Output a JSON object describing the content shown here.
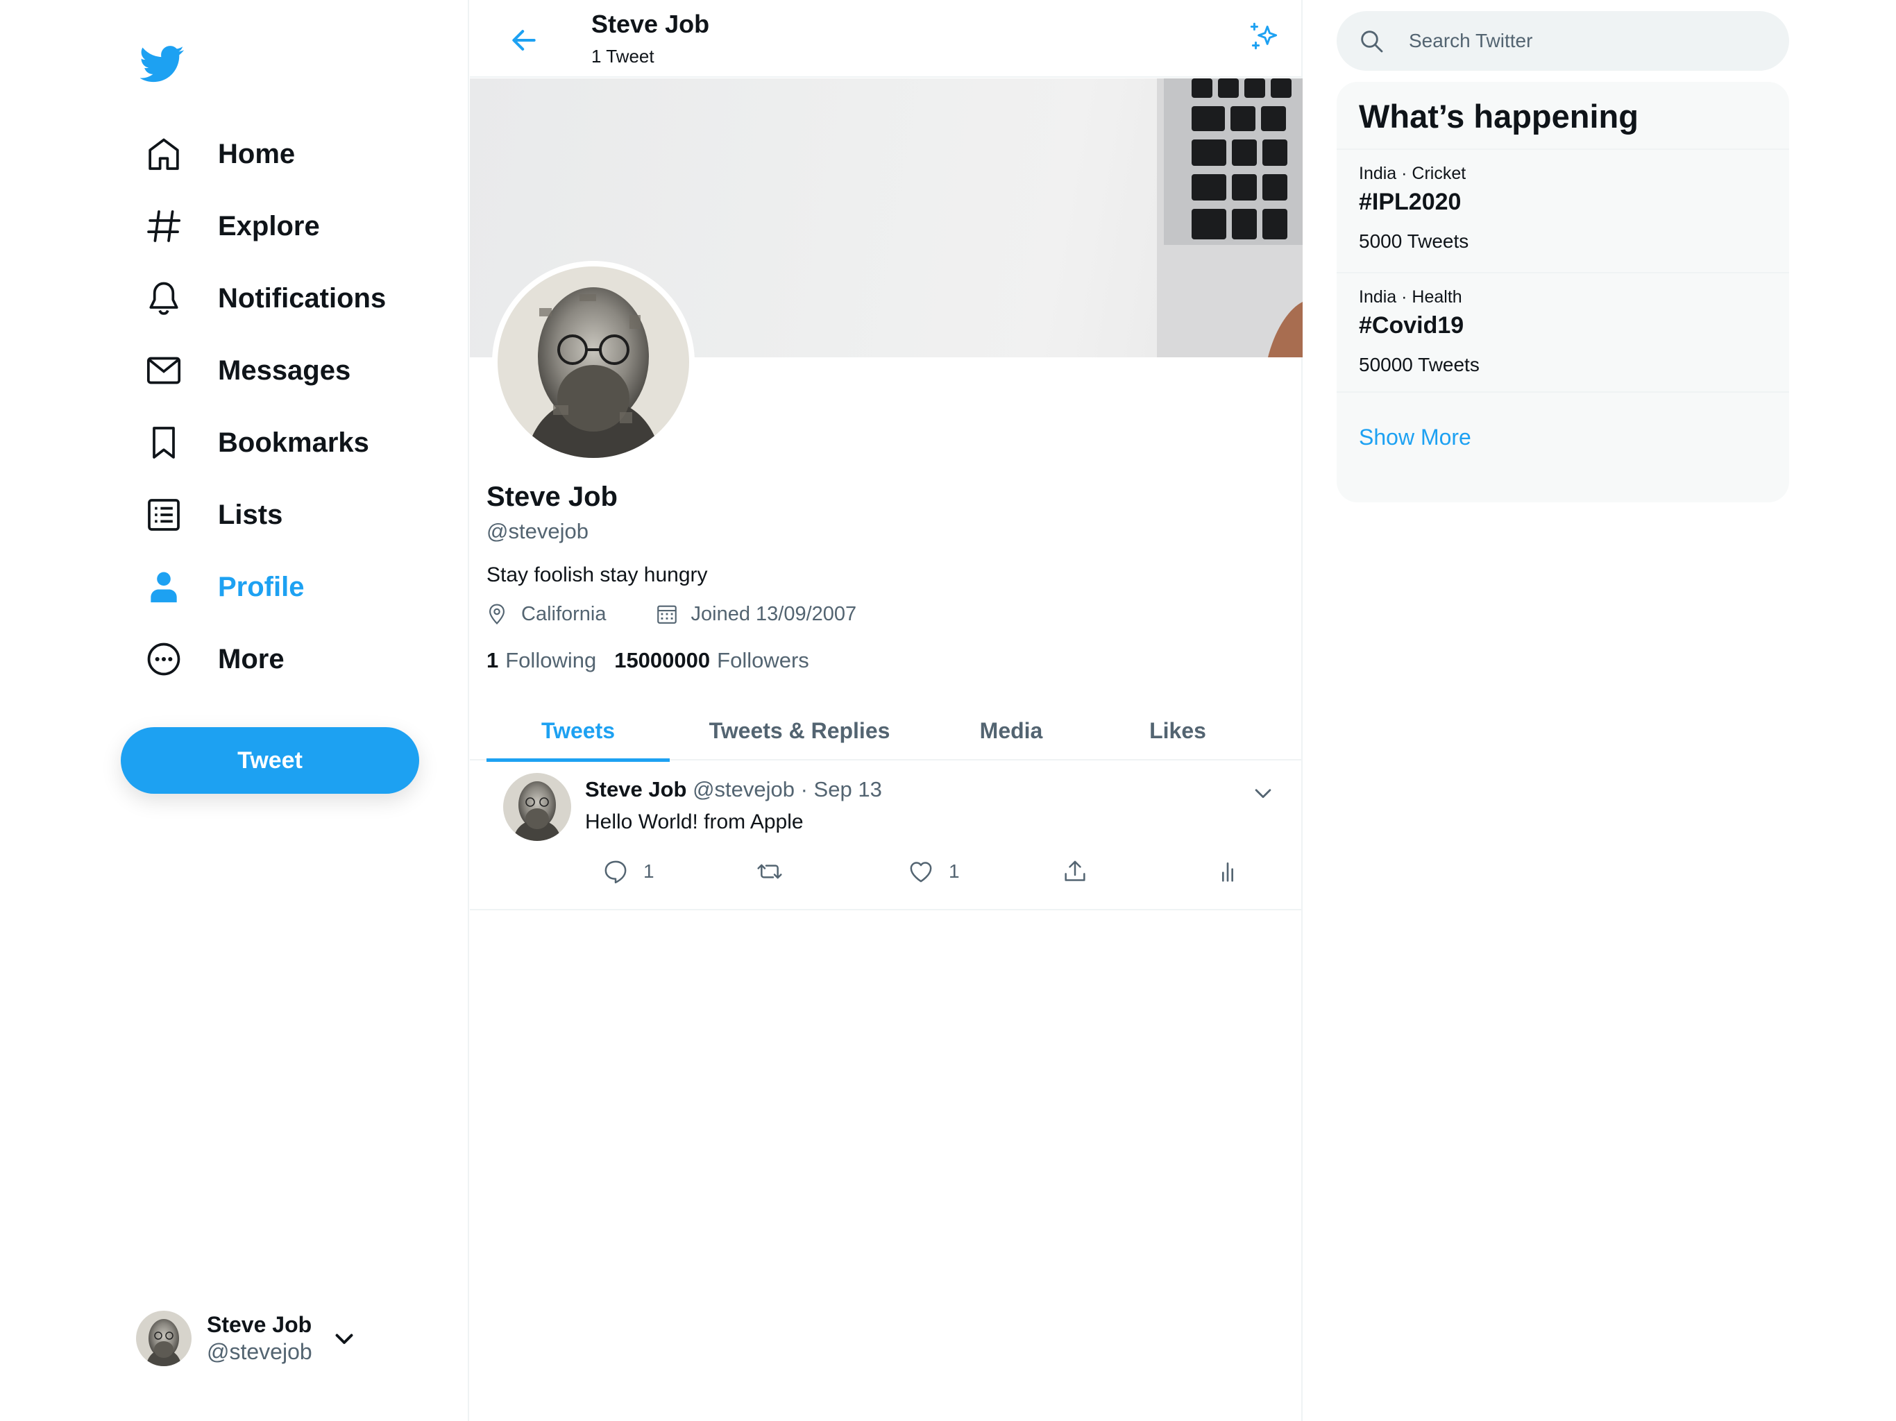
{
  "colors": {
    "accent": "#1da1f2",
    "text": "#0f1419",
    "muted": "#536471",
    "border": "#eff3f4"
  },
  "sidebar": {
    "logo_icon": "twitter-bird-icon",
    "items": [
      {
        "label": "Home",
        "icon": "home-icon",
        "active": false
      },
      {
        "label": "Explore",
        "icon": "hashtag-icon",
        "active": false
      },
      {
        "label": "Notifications",
        "icon": "bell-icon",
        "active": false
      },
      {
        "label": "Messages",
        "icon": "envelope-icon",
        "active": false
      },
      {
        "label": "Bookmarks",
        "icon": "bookmark-icon",
        "active": false
      },
      {
        "label": "Lists",
        "icon": "list-icon",
        "active": false
      },
      {
        "label": "Profile",
        "icon": "user-icon",
        "active": true
      },
      {
        "label": "More",
        "icon": "more-circle-icon",
        "active": false
      }
    ],
    "tweet_button": "Tweet",
    "account": {
      "name": "Steve Job",
      "handle": "@stevejob"
    }
  },
  "header": {
    "title": "Steve Job",
    "subtitle": "1 Tweet"
  },
  "profile": {
    "name": "Steve Job",
    "handle": "@stevejob",
    "bio": "Stay foolish stay hungry",
    "location": "California",
    "joined": "Joined 13/09/2007",
    "following_count": "1",
    "following_label": "Following",
    "followers_count": "15000000",
    "followers_label": "Followers"
  },
  "tabs": [
    {
      "label": "Tweets",
      "active": true
    },
    {
      "label": "Tweets & Replies",
      "active": false
    },
    {
      "label": "Media",
      "active": false
    },
    {
      "label": "Likes",
      "active": false
    }
  ],
  "tweets": [
    {
      "name": "Steve Job",
      "meta": "@stevejob · Sep 13",
      "text": "Hello World! from Apple",
      "replies": "1",
      "likes": "1"
    }
  ],
  "search": {
    "placeholder": "Search Twitter"
  },
  "trends": {
    "title": "What’s happening",
    "items": [
      {
        "category": "India · Cricket",
        "tag": "#IPL2020",
        "count": "5000 Tweets"
      },
      {
        "category": "India · Health",
        "tag": "#Covid19",
        "count": "50000 Tweets"
      }
    ],
    "show_more": "Show More"
  }
}
